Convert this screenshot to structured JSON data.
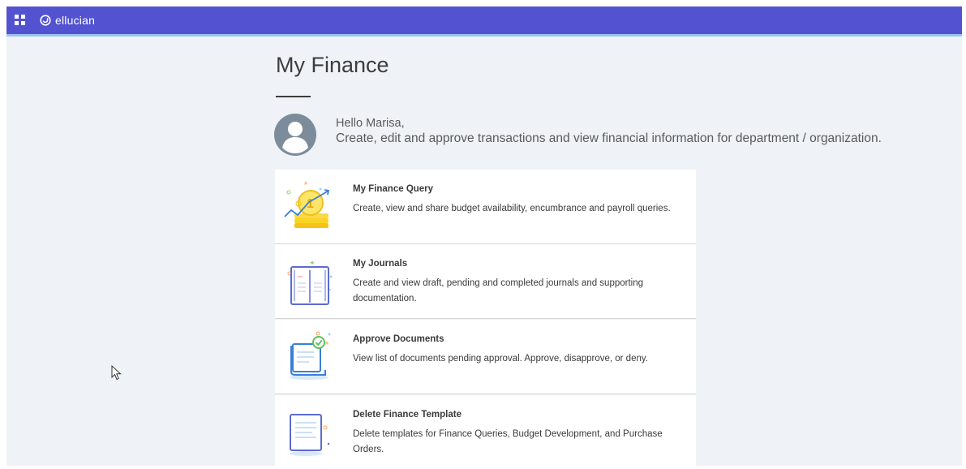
{
  "app": {
    "brand": "ellucian"
  },
  "page": {
    "title": "My Finance"
  },
  "greeting": {
    "line1": "Hello Marisa,",
    "line2": "Create, edit and approve transactions and view financial information for department / organization."
  },
  "cards": [
    {
      "title": "My Finance Query",
      "description": "Create, view and share budget availability, encumbrance and payroll queries.",
      "icon": "coins-chart-icon"
    },
    {
      "title": "My Journals",
      "description": "Create and view draft, pending and completed journals and supporting documentation.",
      "icon": "journal-book-icon"
    },
    {
      "title": "Approve Documents",
      "description": "View list of documents pending approval. Approve, disapprove, or deny.",
      "icon": "approve-document-icon"
    },
    {
      "title": "Delete Finance Template",
      "description": "Delete templates for Finance Queries, Budget Development, and Purchase Orders.",
      "icon": "finance-template-icon"
    }
  ],
  "colors": {
    "topbar": "#5353d1",
    "background": "#eff3f7",
    "card": "#ffffff",
    "text": "#3a3a3a"
  }
}
